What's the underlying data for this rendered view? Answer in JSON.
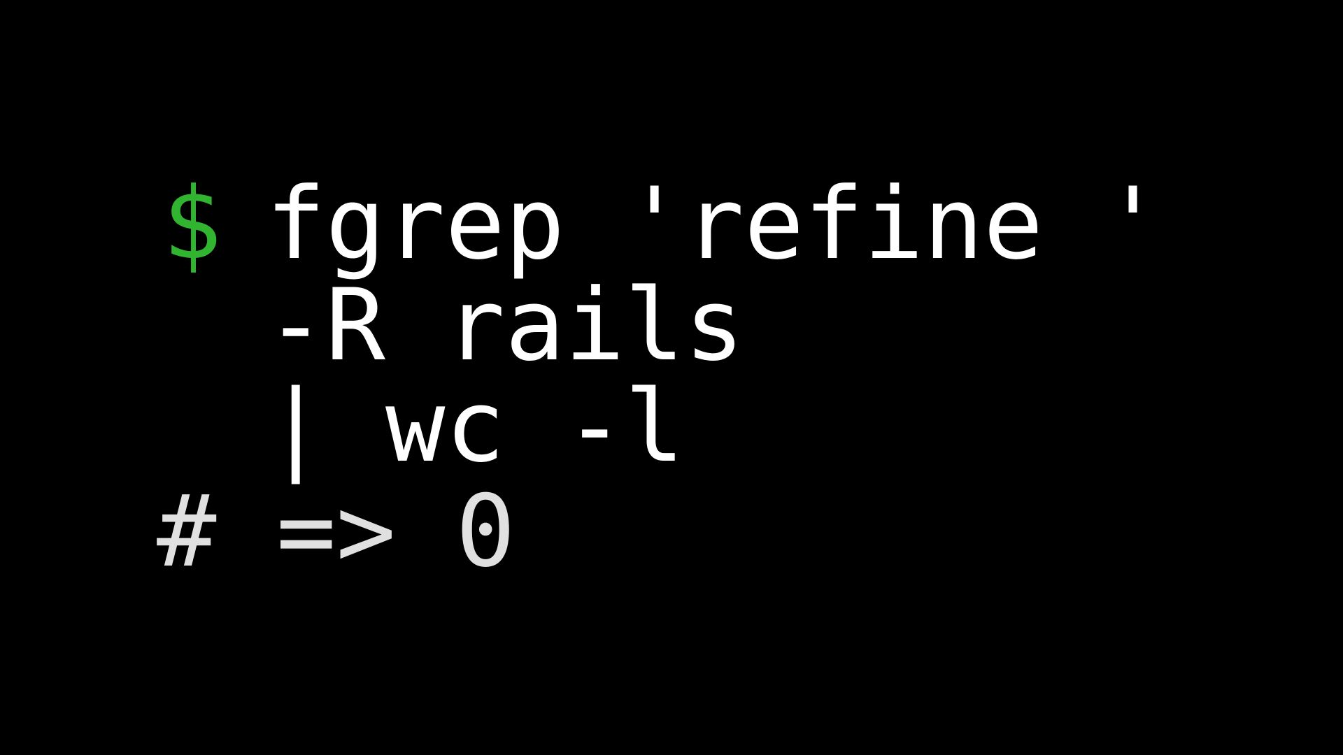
{
  "terminal": {
    "prompt_symbol": "$",
    "lines": [
      "fgrep 'refine '",
      "-R rails",
      "| wc -l"
    ],
    "output": "# => 0",
    "colors": {
      "background": "#000000",
      "prompt": "#31b531",
      "command": "#ffffff",
      "output": "#e0e0e0"
    }
  }
}
